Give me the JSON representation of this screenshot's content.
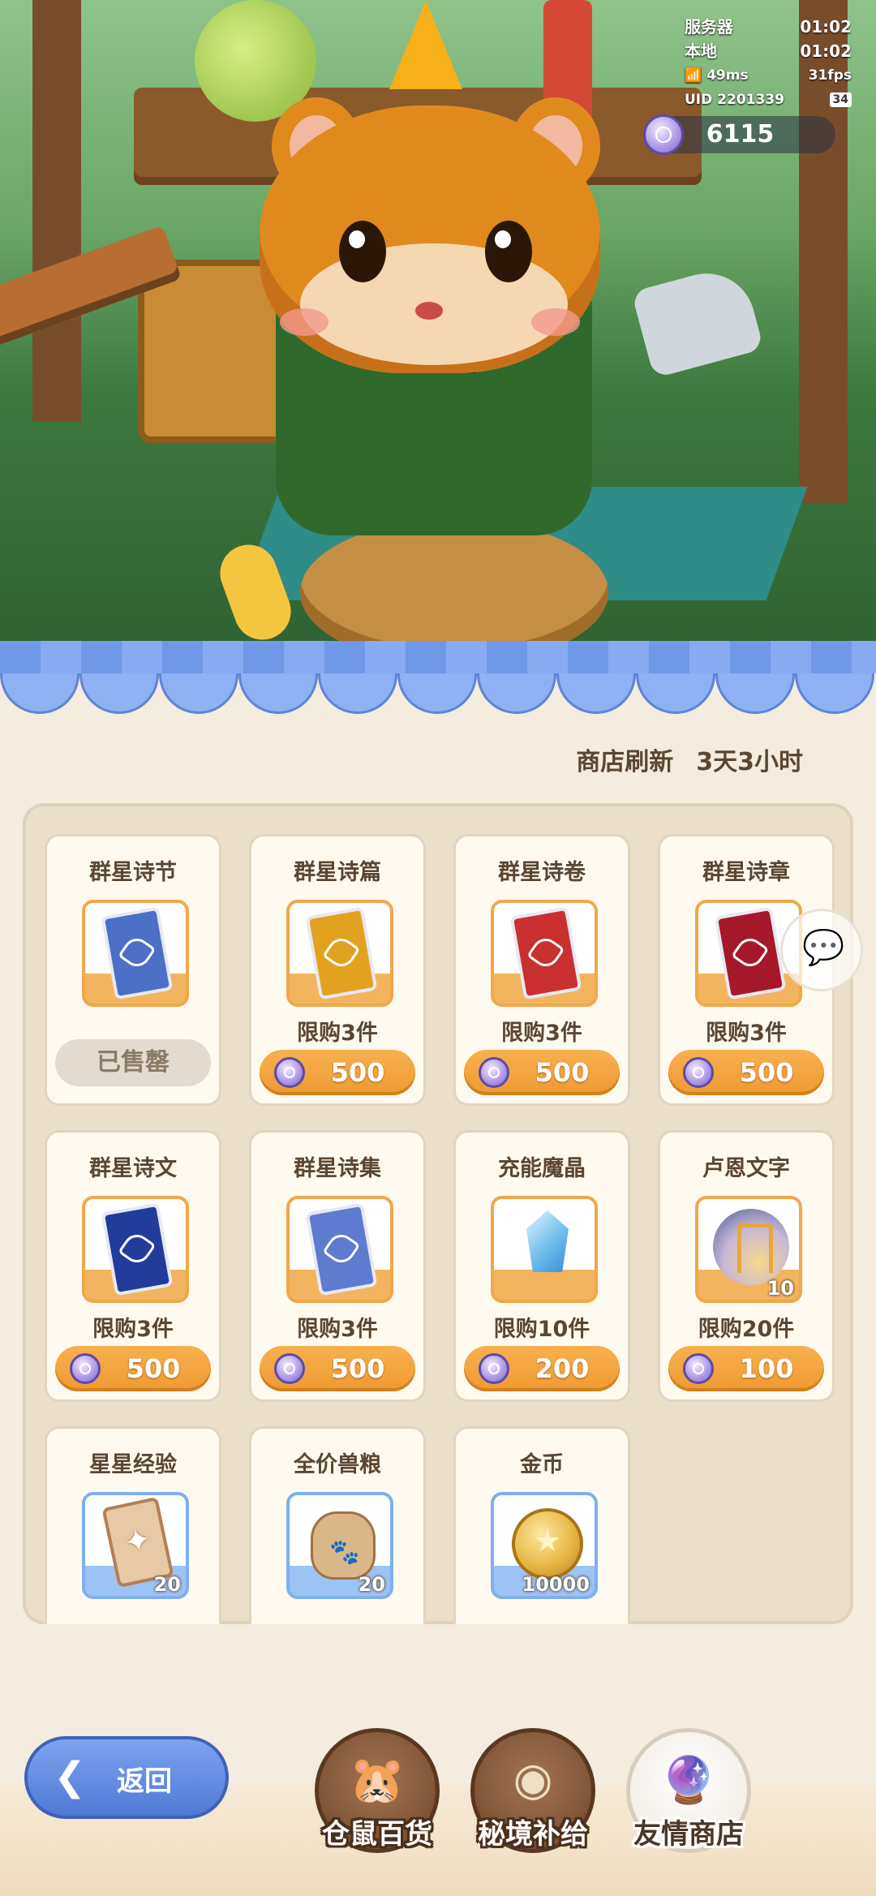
{
  "hud": {
    "server_label": "服务器",
    "server_time": "01:02",
    "local_label": "本地",
    "local_time": "01:02",
    "ping": "49ms",
    "fps": "31fps",
    "uid": "UID 2201339",
    "battery": "34"
  },
  "currency": {
    "amount": "6115",
    "icon": "purple-gem-coin"
  },
  "shop": {
    "refresh_label": "商店刷新",
    "refresh_time": "3天3小时",
    "items": [
      {
        "name": "群星诗节",
        "icon": "tarot-card-blue",
        "card_color": "#4c6fc7",
        "limit": "",
        "price": "",
        "status": "已售罄",
        "qty": ""
      },
      {
        "name": "群星诗篇",
        "icon": "tarot-card-gold",
        "card_color": "#e2a21f",
        "limit": "限购3件",
        "price": "500",
        "status": "",
        "qty": ""
      },
      {
        "name": "群星诗卷",
        "icon": "tarot-card-red",
        "card_color": "#c9302f",
        "limit": "限购3件",
        "price": "500",
        "status": "",
        "qty": ""
      },
      {
        "name": "群星诗章",
        "icon": "tarot-card-crimson",
        "card_color": "#a5182a",
        "limit": "限购3件",
        "price": "500",
        "status": "",
        "qty": ""
      },
      {
        "name": "群星诗文",
        "icon": "tarot-card-navy",
        "card_color": "#223c9c",
        "limit": "限购3件",
        "price": "500",
        "status": "",
        "qty": ""
      },
      {
        "name": "群星诗集",
        "icon": "tarot-card-moon",
        "card_color": "#5d7bcf",
        "limit": "限购3件",
        "price": "500",
        "status": "",
        "qty": ""
      },
      {
        "name": "充能魔晶",
        "icon": "crystal-icon",
        "card_color": "",
        "limit": "限购10件",
        "price": "200",
        "status": "",
        "qty": ""
      },
      {
        "name": "卢恩文字",
        "icon": "rune-stone-icon",
        "card_color": "",
        "limit": "限购20件",
        "price": "100",
        "status": "",
        "qty": "10"
      },
      {
        "name": "星星经验",
        "icon": "star-exp-card-icon",
        "card_color": "",
        "limit": "",
        "price": "",
        "status": "",
        "qty": "20"
      },
      {
        "name": "全价兽粮",
        "icon": "pet-food-bag-icon",
        "card_color": "",
        "limit": "",
        "price": "",
        "status": "",
        "qty": "20"
      },
      {
        "name": "金币",
        "icon": "gold-coin-icon",
        "card_color": "",
        "limit": "",
        "price": "",
        "status": "",
        "qty": "10000"
      }
    ]
  },
  "bottom_nav": {
    "back_label": "返回",
    "tabs": [
      {
        "label": "仓鼠百货",
        "icon": "hamster-icon",
        "active": false
      },
      {
        "label": "秘境补给",
        "icon": "eye-emblem-icon",
        "active": false
      },
      {
        "label": "友情商店",
        "icon": "crystal-ball-icon",
        "active": true
      }
    ]
  }
}
